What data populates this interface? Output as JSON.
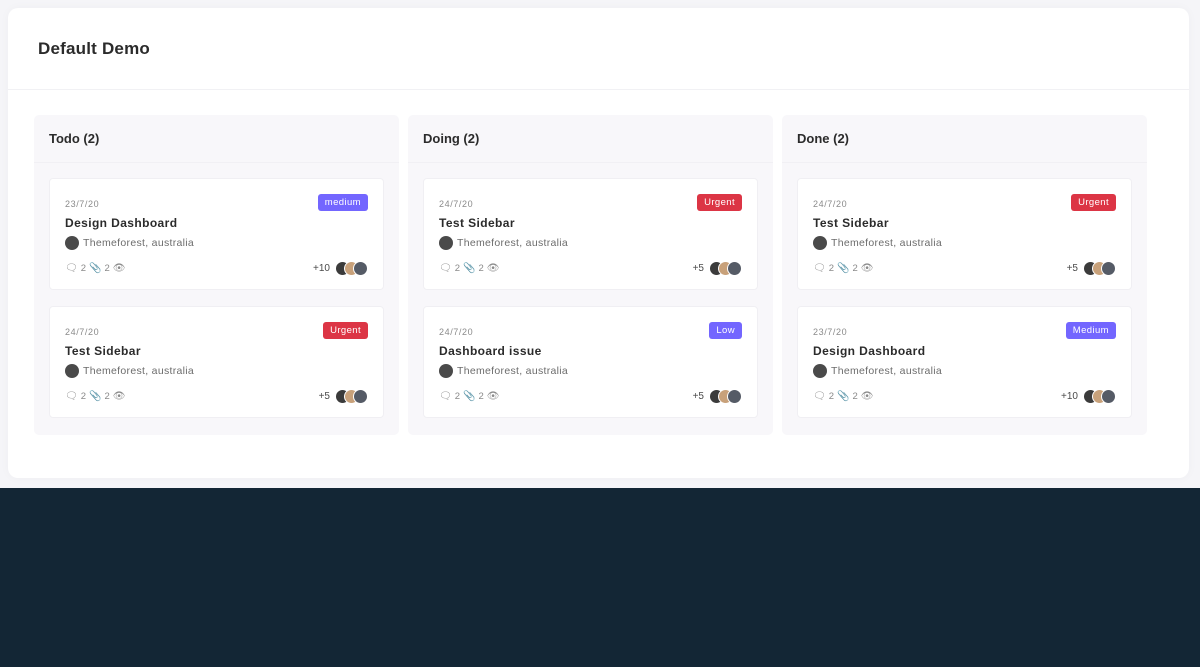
{
  "page": {
    "title": "Default Demo"
  },
  "colors": {
    "urgent": "#dc3545",
    "medium": "#7366ff",
    "low": "#7366ff",
    "footer": "#132635"
  },
  "columns": [
    {
      "title": "Todo (2)",
      "tasks": [
        {
          "date": "23/7/20",
          "badge": "medium",
          "badge_color": "#7366ff",
          "title": "Design Dashboard",
          "client": "Themeforest, australia",
          "comments": "2",
          "attachments": "2",
          "views": "2",
          "members_more": "+10"
        },
        {
          "date": "24/7/20",
          "badge": "Urgent",
          "badge_color": "#dc3545",
          "title": "Test Sidebar",
          "client": "Themeforest, australia",
          "comments": "2",
          "attachments": "2",
          "views": "2",
          "members_more": "+5"
        }
      ]
    },
    {
      "title": "Doing (2)",
      "tasks": [
        {
          "date": "24/7/20",
          "badge": "Urgent",
          "badge_color": "#dc3545",
          "title": "Test Sidebar",
          "client": "Themeforest, australia",
          "comments": "2",
          "attachments": "2",
          "views": "2",
          "members_more": "+5"
        },
        {
          "date": "24/7/20",
          "badge": "Low",
          "badge_color": "#7366ff",
          "title": "Dashboard issue",
          "client": "Themeforest, australia",
          "comments": "2",
          "attachments": "2",
          "views": "2",
          "members_more": "+5"
        }
      ]
    },
    {
      "title": "Done (2)",
      "tasks": [
        {
          "date": "24/7/20",
          "badge": "Urgent",
          "badge_color": "#dc3545",
          "title": "Test Sidebar",
          "client": "Themeforest, australia",
          "comments": "2",
          "attachments": "2",
          "views": "2",
          "members_more": "+5"
        },
        {
          "date": "23/7/20",
          "badge": "Medium",
          "badge_color": "#7366ff",
          "title": "Design Dashboard",
          "client": "Themeforest, australia",
          "comments": "2",
          "attachments": "2",
          "views": "2",
          "members_more": "+10"
        }
      ]
    }
  ]
}
